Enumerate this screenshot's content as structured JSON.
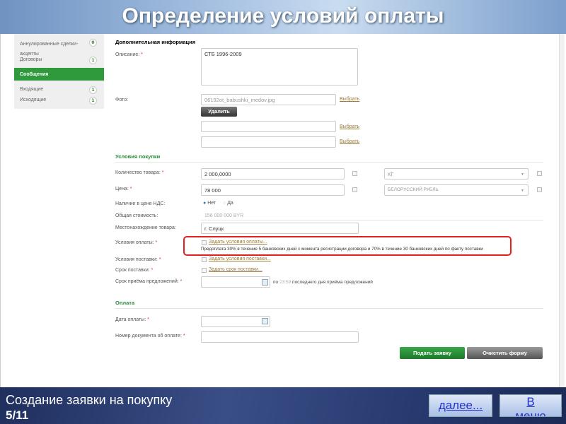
{
  "title": "Определение условий оплаты",
  "sidebar": {
    "items": [
      {
        "label": "Аннулированные сделки-акцепты",
        "count": "0"
      },
      {
        "label": "Договоры",
        "count": "1"
      },
      {
        "label": "Сообщения"
      },
      {
        "label": "Входящие",
        "count": "1"
      },
      {
        "label": "Исходящие",
        "count": "1"
      }
    ]
  },
  "extra": {
    "heading": "Дополнительная информация",
    "desc_label": "Описание:",
    "desc_value": "СТБ 1996-2009",
    "photo_label": "Фото:",
    "photo_file": "06192ot_babushki_medov.jpg",
    "choose": "Выбрать",
    "delete": "Удалить"
  },
  "purchase": {
    "heading": "Условия покупки",
    "qty_label": "Количество товара:",
    "qty": "2 000,0000",
    "unit": "КГ",
    "price_label": "Цена:",
    "price": "78 000",
    "currency": "БЕЛОРУССКИЙ РУБЛЬ",
    "vat_label": "Наличие в цене НДС:",
    "vat_no": "Нет",
    "vat_yes": "Да",
    "total_label": "Общая стоимость:",
    "total": "156 000 000 BYR",
    "loc_label": "Местонахождение товара:",
    "loc": "г. Слуцк",
    "pay_label": "Условия оплаты:",
    "pay_link": "Задать условия оплаты...",
    "pay_text": "Предоплата 30% в течение 5 банковских дней с момента регистрации договора и 70% в течение 30 банковских дней по факту поставки",
    "delivery_label": "Условия поставки:",
    "delivery_link": "Задать условия поставки...",
    "term_label": "Срок поставки:",
    "term_link": "Задать срок поставки...",
    "offers_label": "Срок приёма предложений:",
    "offers_pre": "по",
    "offers_time": "23:59",
    "offers_post": "последнего дня приёма предложений"
  },
  "payment": {
    "heading": "Оплата",
    "date_label": "Дата оплаты:",
    "doc_label": "Номер документа об оплате:",
    "submit": "Подать заявку",
    "clear": "Очистить форму"
  },
  "footer": {
    "caption": "Создание заявки на покупку",
    "page": "5/11",
    "next": "далее...",
    "menu": "В меню"
  }
}
